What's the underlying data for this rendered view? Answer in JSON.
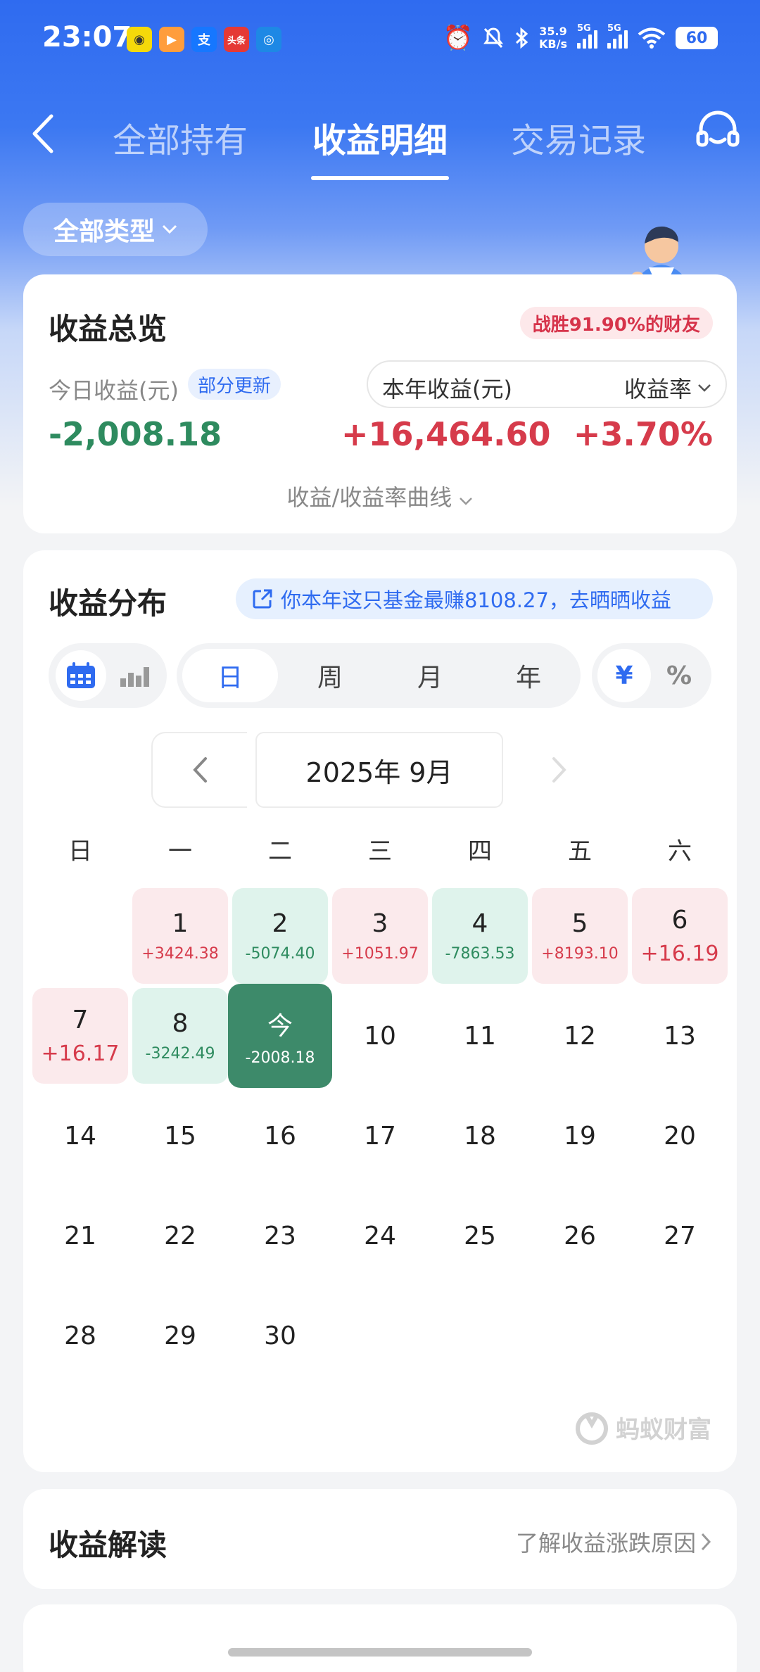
{
  "status_bar": {
    "time": "23:07",
    "net_speed_value": "35.9",
    "net_speed_unit": "KB/s",
    "signal1": "5G",
    "signal2": "5G",
    "battery": "60"
  },
  "nav": {
    "tabs": [
      {
        "label": "全部持有"
      },
      {
        "label": "收益明细"
      },
      {
        "label": "交易记录"
      }
    ]
  },
  "filter": {
    "type_label": "全部类型"
  },
  "overview": {
    "title": "收益总览",
    "win_badge": "战胜91.90%的财友",
    "today_label": "今日收益(元)",
    "partial_badge": "部分更新",
    "today_value": "-2,008.18",
    "year_label": "本年收益(元)",
    "rate_select": "收益率",
    "year_value": "+16,464.60",
    "rate_value": "+3.70%",
    "curve_toggle": "收益/收益率曲线"
  },
  "distribution": {
    "title": "收益分布",
    "share_banner": "你本年这只基金最赚8108.27，去晒晒收益",
    "periods": [
      "日",
      "周",
      "月",
      "年"
    ],
    "units": [
      "¥",
      "%"
    ],
    "month": "2025年 9月",
    "weekdays": [
      "日",
      "一",
      "二",
      "三",
      "四",
      "五",
      "六"
    ],
    "days": [
      {
        "n": "1",
        "amt": "+3424.38"
      },
      {
        "n": "2",
        "amt": "-5074.40"
      },
      {
        "n": "3",
        "amt": "+1051.97"
      },
      {
        "n": "4",
        "amt": "-7863.53"
      },
      {
        "n": "5",
        "amt": "+8193.10"
      },
      {
        "n": "6",
        "amt": "+16.19"
      },
      {
        "n": "7",
        "amt": "+16.17"
      },
      {
        "n": "8",
        "amt": "-3242.49"
      },
      {
        "n": "今",
        "amt": "-2008.18"
      },
      {
        "n": "10"
      },
      {
        "n": "11"
      },
      {
        "n": "12"
      },
      {
        "n": "13"
      },
      {
        "n": "14"
      },
      {
        "n": "15"
      },
      {
        "n": "16"
      },
      {
        "n": "17"
      },
      {
        "n": "18"
      },
      {
        "n": "19"
      },
      {
        "n": "20"
      },
      {
        "n": "21"
      },
      {
        "n": "22"
      },
      {
        "n": "23"
      },
      {
        "n": "24"
      },
      {
        "n": "25"
      },
      {
        "n": "26"
      },
      {
        "n": "27"
      },
      {
        "n": "28"
      },
      {
        "n": "29"
      },
      {
        "n": "30"
      }
    ],
    "watermark": "蚂蚁财富"
  },
  "reading": {
    "title": "收益解读",
    "link": "了解收益涨跌原因"
  },
  "colors": {
    "brand_blue": "#2f6bf0",
    "gain_red": "#d63b4b",
    "loss_green": "#2e8b5f",
    "today_green": "#3d8a6a"
  }
}
